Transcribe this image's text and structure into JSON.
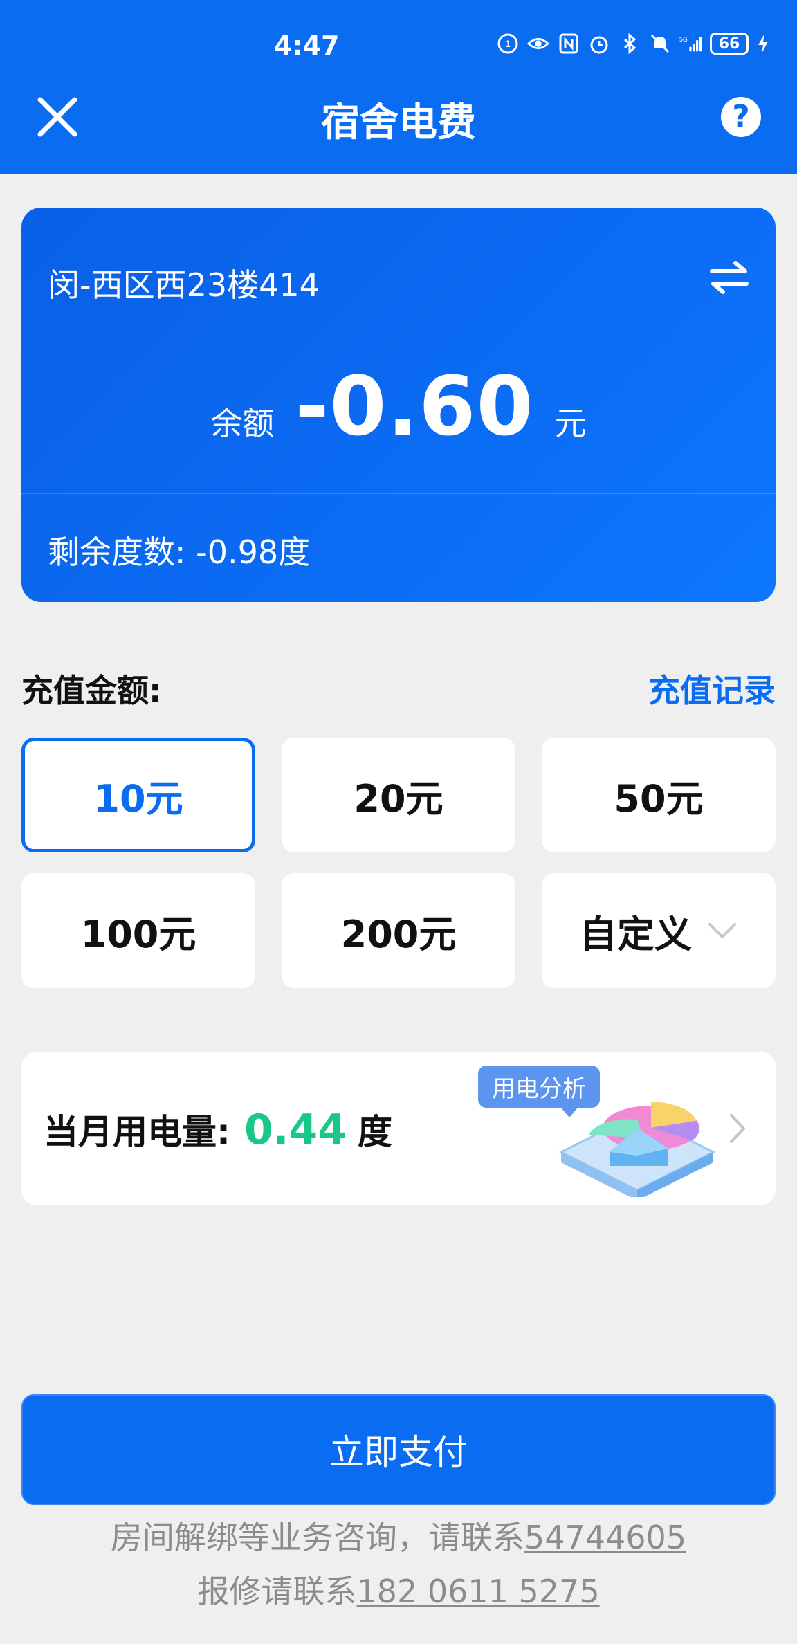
{
  "status_bar": {
    "time": "4:47",
    "battery": "66"
  },
  "header": {
    "title": "宿舍电费",
    "close_icon": "close-icon",
    "help_icon": "help-icon",
    "help_glyph": "?"
  },
  "card": {
    "room": "闵-西区西23楼414",
    "balance_label": "余额",
    "balance_value": "-0.60",
    "balance_unit": "元",
    "remaining": "剩余度数: -0.98度",
    "switch_icon": "switch-room-icon"
  },
  "recharge": {
    "label": "充值金额:",
    "history_link": "充值记录",
    "options": [
      "10元",
      "20元",
      "50元",
      "100元",
      "200元",
      "自定义"
    ],
    "selected_index": 0
  },
  "usage": {
    "label": "当月用电量:",
    "value": "0.44",
    "unit": "度",
    "badge": "用电分析"
  },
  "pay": {
    "label": "立即支付"
  },
  "footer": {
    "line1_text": "房间解绑等业务咨询，请联系",
    "line1_phone": "54744605",
    "line2_text": "报修请联系",
    "line2_phone": "182 0611 5275"
  },
  "colors": {
    "primary": "#0a6cf0",
    "usage_value": "#19c887"
  }
}
